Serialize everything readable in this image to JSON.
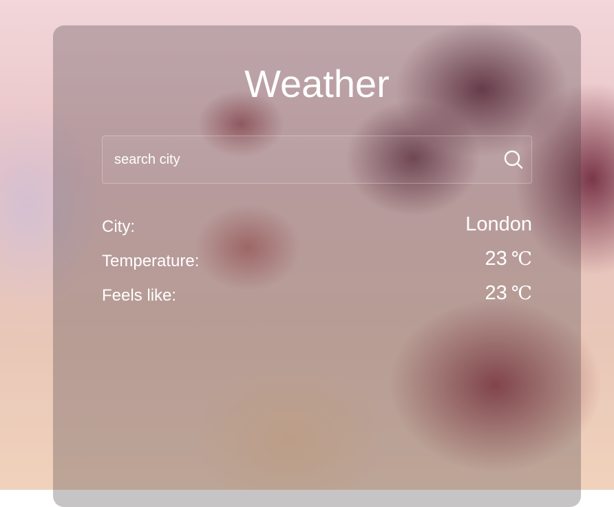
{
  "app": {
    "title": "Weather"
  },
  "search": {
    "placeholder": "search city",
    "value": "",
    "icon": "search-icon"
  },
  "info": {
    "city_label": "City:",
    "city_value": "London",
    "temperature_label": "Temperature:",
    "temperature_value": "23",
    "temperature_unit": "℃",
    "feels_like_label": "Feels like:",
    "feels_like_value": "23",
    "feels_like_unit": "℃"
  },
  "colors": {
    "text": "#ffffff",
    "card_overlay": "rgba(70,60,65,0.30)"
  }
}
